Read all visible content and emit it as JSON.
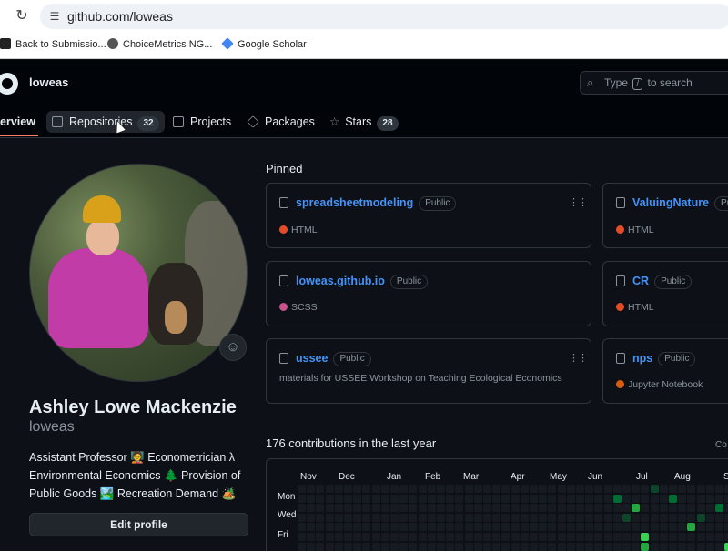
{
  "browser": {
    "url": "github.com/loweas",
    "bookmarks": [
      {
        "label": "Back to Submissio...",
        "icon": "bookmark-m-icon",
        "color": "#222222"
      },
      {
        "label": "ChoiceMetrics NG...",
        "icon": "globe-icon",
        "color": "#555555"
      },
      {
        "label": "Google Scholar",
        "icon": "scholar-icon",
        "color": "#4285f4"
      }
    ]
  },
  "header": {
    "username": "loweas",
    "search_prefix": "Type",
    "search_key": "/",
    "search_suffix": "to search"
  },
  "tabs": [
    {
      "label": "Overview",
      "display": "erview",
      "active": true
    },
    {
      "label": "Repositories",
      "count": "32"
    },
    {
      "label": "Projects"
    },
    {
      "label": "Packages"
    },
    {
      "label": "Stars",
      "count": "28"
    }
  ],
  "profile": {
    "name": "Ashley Lowe Mackenzie",
    "login": "loweas",
    "bio_lines": [
      "Assistant Professor 🧑‍🏫 Econometrician λ",
      "Environmental Economics 🌲 Provision of",
      "Public Goods 🏞️ Recreation Demand 🏕️"
    ],
    "edit_label": "Edit profile"
  },
  "pinned": {
    "title": "Pinned",
    "cards": [
      {
        "name": "spreadsheetmodeling",
        "visibility": "Public",
        "language": "HTML",
        "lang_color": "#e34c26"
      },
      {
        "name": "ValuingNature",
        "visibility": "Publ",
        "language": "HTML",
        "lang_color": "#e34c26"
      },
      {
        "name": "loweas.github.io",
        "visibility": "Public",
        "language": "SCSS",
        "lang_color": "#c6538c"
      },
      {
        "name": "CR",
        "visibility": "Public",
        "language": "HTML",
        "lang_color": "#e34c26"
      },
      {
        "name": "ussee",
        "visibility": "Public",
        "description": "materials for USSEE Workshop on Teaching Ecological Economics"
      },
      {
        "name": "nps",
        "visibility": "Public",
        "language": "Jupyter Notebook",
        "lang_color": "#da5b0b"
      }
    ]
  },
  "contributions": {
    "title": "176 contributions in the last year",
    "settings_label": "Co",
    "months": [
      "Nov",
      "Dec",
      "Jan",
      "Feb",
      "Mar",
      "Apr",
      "May",
      "Jun",
      "Jul",
      "Aug",
      "S"
    ],
    "days": [
      "Mon",
      "Wed",
      "Fri"
    ],
    "colors": {
      "empty": "#161b22",
      "l1": "#0e4429",
      "l2": "#006d32",
      "l3": "#26a641",
      "l4": "#39d353"
    }
  }
}
